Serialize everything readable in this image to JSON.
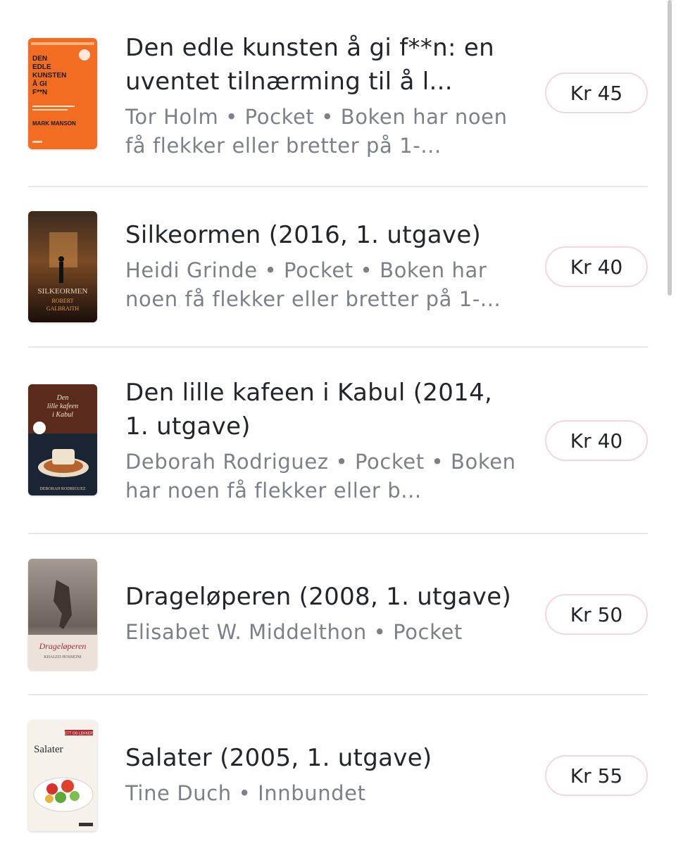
{
  "books": [
    {
      "title": "Den edle kunsten å gi f**n: en uventet tilnærming til å l...",
      "meta": "Tor Holm • Pocket • Boken har noen få flekker eller bretter på 1-...",
      "price": "Kr 45",
      "cover_icon": "book-cover-den-edle-kunsten",
      "cover_text": "DEN EDLE KUNSTEN Å GI F**N — MARK MANSON"
    },
    {
      "title": "Silkeormen (2016, 1. utgave)",
      "meta": "Heidi Grinde • Pocket • Boken har noen få flekker eller bretter på 1-...",
      "price": "Kr 40",
      "cover_icon": "book-cover-silkeormen",
      "cover_text": "SILKEORMEN — ROBERT GALBRAITH"
    },
    {
      "title": "Den lille kafeen i Kabul (2014, 1. utgave)",
      "meta": "Deborah Rodriguez • Pocket • Boken har noen få flekker eller b...",
      "price": "Kr 40",
      "cover_icon": "book-cover-den-lille-kafeen-i-kabul",
      "cover_text": "Den lille kafeen i Kabul — DEBORAH RODRIGUEZ"
    },
    {
      "title": "Drageløperen (2008, 1. utgave)",
      "meta": "Elisabet W. Middelthon • Pocket",
      "price": "Kr 50",
      "cover_icon": "book-cover-drageloperen",
      "cover_text": "Drageløperen — KHALED HOSSEINI"
    },
    {
      "title": "Salater (2005, 1. utgave)",
      "meta": "Tine Duch • Innbundet",
      "price": "Kr 55",
      "cover_icon": "book-cover-salater",
      "cover_text": "Salater — LETT OG LEKKERT"
    }
  ],
  "colors": {
    "divider": "#f3e3e9",
    "price_border": "#f4d6df",
    "meta_text": "#7b8089",
    "title_text": "#22262b"
  }
}
